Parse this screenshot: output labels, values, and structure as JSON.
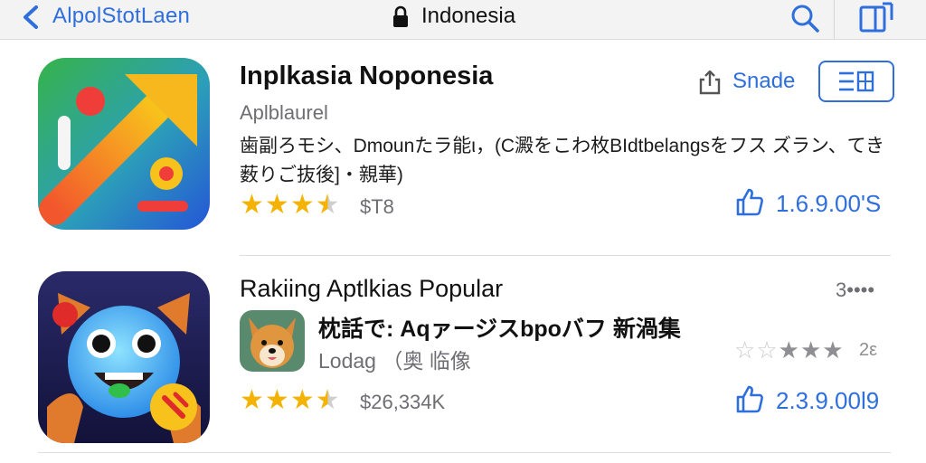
{
  "topbar": {
    "back_label": "AlpolStotLaen",
    "address_title": "Indonesia",
    "icons": [
      "back-chevron-icon",
      "lock-icon",
      "search-icon",
      "tabs-icon"
    ]
  },
  "app1": {
    "title": "Inplkasia Noponesia",
    "subtitle": "Aplblaurel",
    "description": "歯副ろモシ、Dmounたラ能ι，(C澱をこわ枚BIdtbelangsをフス ズラン、てき薮りご抜後]・親華)",
    "share_label": "Snade",
    "rating": 3.5,
    "price": "$T8",
    "count": "1.6.9.00'S",
    "accent": "#2f6fdc"
  },
  "section": {
    "title": "Rakiing Aptlkias Popular",
    "more_label": "3••••"
  },
  "app2": {
    "sub_title": "枕話で: Aqァージスbpoバフ 新渦集",
    "sub_desc": "Lodag （奥 临像",
    "sub_rating": 2,
    "sub_star_count": "2ε",
    "rating": 3.5,
    "price": "$26,334K",
    "count": "2.3.9.00l9"
  },
  "colors": {
    "star": "#f5b301",
    "link": "#2f6fdc",
    "muted": "#6e6e73"
  }
}
